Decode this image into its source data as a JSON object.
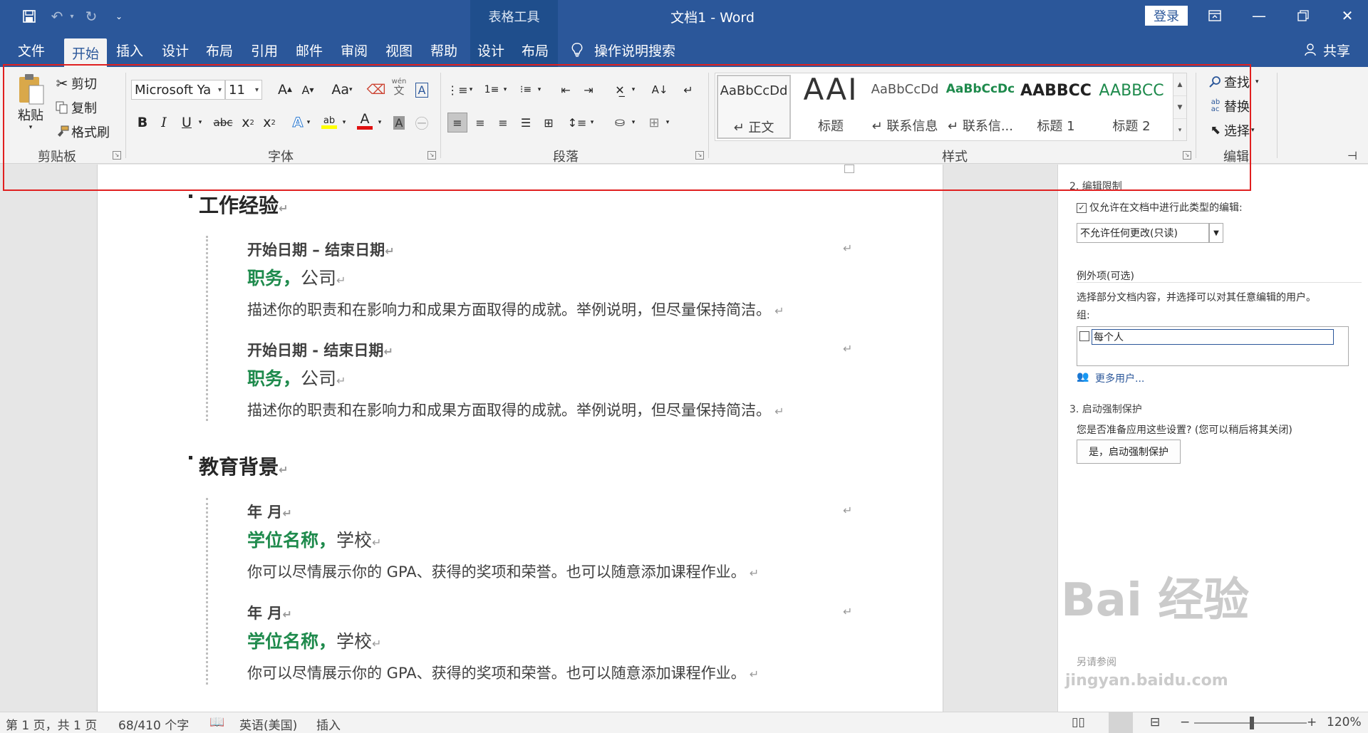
{
  "titlebar": {
    "context_tab_title": "表格工具",
    "doc_title": "文档1  -  Word",
    "login": "登录"
  },
  "tabs": {
    "file": "文件",
    "home": "开始",
    "insert": "插入",
    "design": "设计",
    "layout": "布局",
    "references": "引用",
    "mailings": "邮件",
    "review": "审阅",
    "view": "视图",
    "help": "帮助",
    "table_design": "设计",
    "table_layout": "布局",
    "tell_me": "操作说明搜索",
    "share": "共享"
  },
  "ribbon": {
    "clipboard": {
      "paste": "粘贴",
      "cut": "剪切",
      "copy": "复制",
      "format_painter": "格式刷",
      "label": "剪贴板"
    },
    "font": {
      "font_name": "Microsoft Ya",
      "font_size": "11",
      "label": "字体",
      "case": "Aa",
      "phonetic_top": "wén",
      "phonetic_bottom": "文"
    },
    "paragraph": {
      "label": "段落"
    },
    "styles": {
      "label": "样式",
      "items": [
        {
          "sample": "AaBbCcDd",
          "name": "↵ 正文"
        },
        {
          "sample": "AAI",
          "name": "标题"
        },
        {
          "sample": "AaBbCcDd",
          "name": "↵ 联系信息"
        },
        {
          "sample": "AaBbCcDc",
          "name": "↵ 联系信..."
        },
        {
          "sample": "AABBCC",
          "name": "标题 1"
        },
        {
          "sample": "AABBCC",
          "name": "标题 2"
        }
      ]
    },
    "editing": {
      "find": "查找",
      "replace": "替换",
      "select": "选择",
      "label": "编辑"
    }
  },
  "document": {
    "sections": [
      {
        "heading": "工作经验",
        "entries": [
          {
            "date": "开始日期 – 结束日期",
            "role_bold": "职务，",
            "role_rest": "公司",
            "desc": "描述你的职责和在影响力和成果方面取得的成就。举例说明，但尽量保持简洁。"
          },
          {
            "date": "开始日期 - 结束日期",
            "role_bold": "职务，",
            "role_rest": "公司",
            "desc": "描述你的职责和在影响力和成果方面取得的成就。举例说明，但尽量保持简洁。"
          }
        ]
      },
      {
        "heading": "教育背景",
        "entries": [
          {
            "date": "年 月",
            "role_bold": "学位名称，",
            "role_rest": "学校",
            "desc": "你可以尽情展示你的 GPA、获得的奖项和荣誉。也可以随意添加课程作业。"
          },
          {
            "date": "年 月",
            "role_bold": "学位名称，",
            "role_rest": "学校",
            "desc": "你可以尽情展示你的 GPA、获得的奖项和荣誉。也可以随意添加课程作业。"
          }
        ]
      }
    ]
  },
  "pane": {
    "section2_title": "2. 编辑限制",
    "allow_only_checkbox": "仅允许在文档中进行此类型的编辑:",
    "edit_type": "不允许任何更改(只读)",
    "exceptions_title": "例外项(可选)",
    "exceptions_desc": "选择部分文档内容，并选择可以对其任意编辑的用户。",
    "groups_label": "组:",
    "everyone": "每个人",
    "more_users": "更多用户...",
    "section3_title": "3. 启动强制保护",
    "section3_desc": "您是否准备应用这些设置? (您可以稍后将其关闭)",
    "enforce_button": "是，启动强制保护",
    "see_also": "另请参阅"
  },
  "watermark": {
    "logo": "Bai 经验",
    "url": "jingyan.baidu.com"
  },
  "status": {
    "page": "第 1 页，共 1 页",
    "words": "68/410 个字",
    "language": "英语(美国)",
    "mode": "插入",
    "zoom": "120%"
  },
  "colors": {
    "word_blue": "#2b579a",
    "accent_green": "#1e8a4c",
    "highlight_red": "#e02020"
  }
}
